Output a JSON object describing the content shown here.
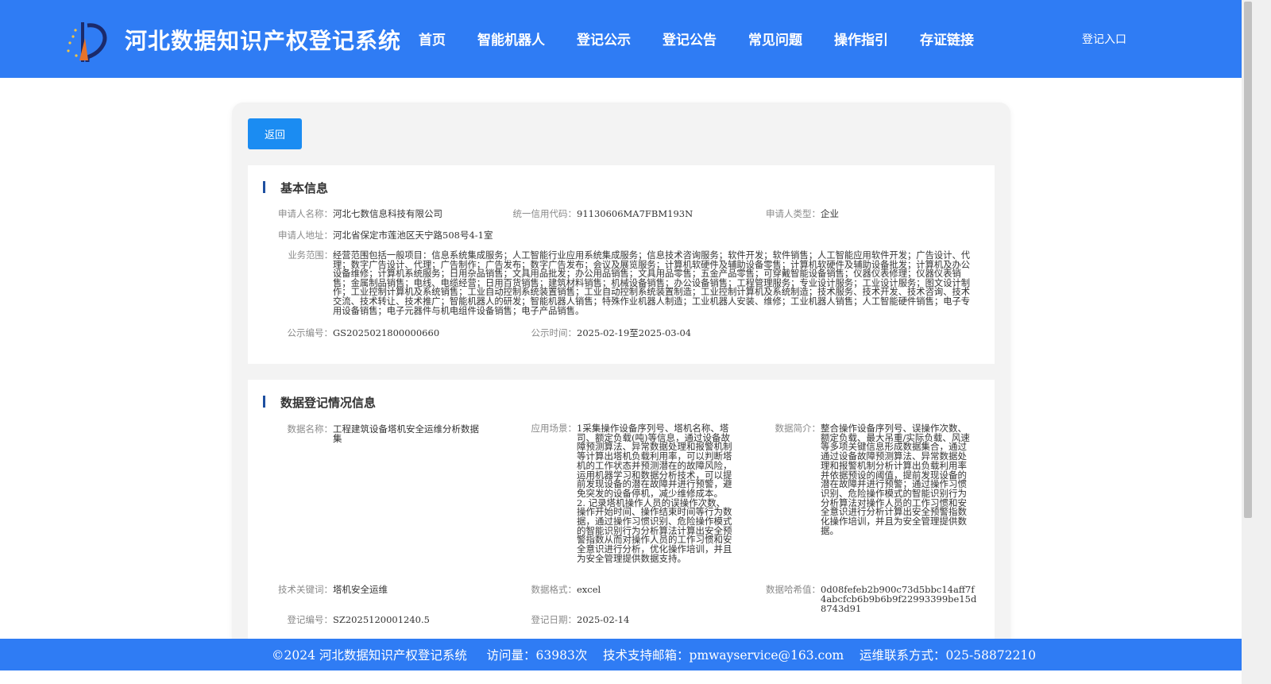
{
  "header": {
    "title": "河北数据知识产权登记系统",
    "nav": [
      "首页",
      "智能机器人",
      "登记公示",
      "登记公告",
      "常见问题",
      "操作指引",
      "存证链接"
    ],
    "login": "登记入口"
  },
  "back_button": "返回",
  "basic": {
    "section_title": "基本信息",
    "applicant_name_label": "申请人名称：",
    "applicant_name": "河北七数信息科技有限公司",
    "credit_code_label": "统一信用代码：",
    "credit_code": "91130606MA7FBM193N",
    "applicant_type_label": "申请人类型：",
    "applicant_type": "企业",
    "address_label": "申请人地址：",
    "address": "河北省保定市莲池区天宁路508号4-1室",
    "scope_label": "业务范围：",
    "scope": "经营范围包括一般项目：信息系统集成服务；人工智能行业应用系统集成服务；信息技术咨询服务；软件开发；软件销售；人工智能应用软件开发；广告设计、代理；数字广告设计、代理；广告制作；广告发布；数字广告发布；会议及展览服务；计算机软硬件及辅助设备零售；计算机软硬件及辅助设备批发；计算机及办公设备维修；计算机系统服务；日用杂品销售；文具用品批发；办公用品销售；文具用品零售；五金产品零售；可穿戴智能设备销售；仪器仪表修理；仪器仪表销售；金属制品销售；电线、电缆经营；日用百货销售；建筑材料销售；机械设备销售；办公设备销售；工程管理服务；专业设计服务；工业设计服务；图文设计制作；工业控制计算机及系统销售；工业自动控制系统装置销售；工业自动控制系统装置制造；工业控制计算机及系统制造；技术服务、技术开发、技术咨询、技术交流、技术转让、技术推广；智能机器人的研发；智能机器人销售；特殊作业机器人制造；工业机器人安装、维修；工业机器人销售；人工智能硬件销售；电子专用设备销售；电子元器件与机电组件设备销售；电子产品销售。",
    "pub_no_label": "公示编号：",
    "pub_no": "GS2025021800000660",
    "pub_time_label": "公示时间：",
    "pub_time": "2025-02-19至2025-03-04"
  },
  "data_info": {
    "section_title": "数据登记情况信息",
    "name_label": "数据名称：",
    "name": "工程建筑设备塔机安全运维分析数据集",
    "scene_label": "应用场景：",
    "scene": "1采集操作设备序列号、塔机名称、塔司、额定负载(吨)等信息，通过设备故障预测算法、异常数据处理和报警机制等计算出塔机负载利用率，可以判断塔机的工作状态并预测潜在的故障风险，运用机器学习和数据分析技术，可以提前发现设备的潜在故障并进行预警，避免突发的设备停机，减少维修成本。 2. 记录塔机操作人员的误操作次数、操作开始时间、操作结束时间等行为数据，通过操作习惯识别、危险操作模式的智能识别行为分析算法计算出安全预警指数从而对操作人员的工作习惯和安全意识进行分析，优化操作培训，并且为安全管理提供数据支持。",
    "summary_label": "数据简介：",
    "summary": "整合操作设备序列号、误操作次数、额定负载、最大吊重/实际负载、风速等多项关键信息形成数据集合，通过通过设备故障预测算法、异常数据处理和报警机制分析计算出负载利用率并依据预设的阈值，提前发现设备的潜在故障并进行预警；通过操作习惯识别、危险操作模式的智能识别行为分析算法对操作人员的工作习惯和安全意识进行分析计算出安全预警指数化操作培训，并且为安全管理提供数据。",
    "keyword_label": "技术关键词：",
    "keyword": "塔机安全运维",
    "format_label": "数据格式：",
    "format": "excel",
    "hash_label": "数据哈希值：",
    "hash": "0d08fefeb2b900c73d5bbc14aff7f4abcfcb6b9b6b9f22993399be15d8743d91",
    "reg_no_label": "登记编号：",
    "reg_no": "SZ2025120001240.5",
    "reg_date_label": "登记日期：",
    "reg_date": "2025-02-14"
  },
  "footer": {
    "text": "©2024 河北数据知识产权登记系统     访问量：63983次    技术支持邮箱：pmwayservice@163.com    运维联系方式：025-58872210"
  },
  "colors": {
    "brand_blue": "#2f7cf4",
    "button_blue": "#1b8cf2",
    "section_bar": "#1e4fa0"
  }
}
